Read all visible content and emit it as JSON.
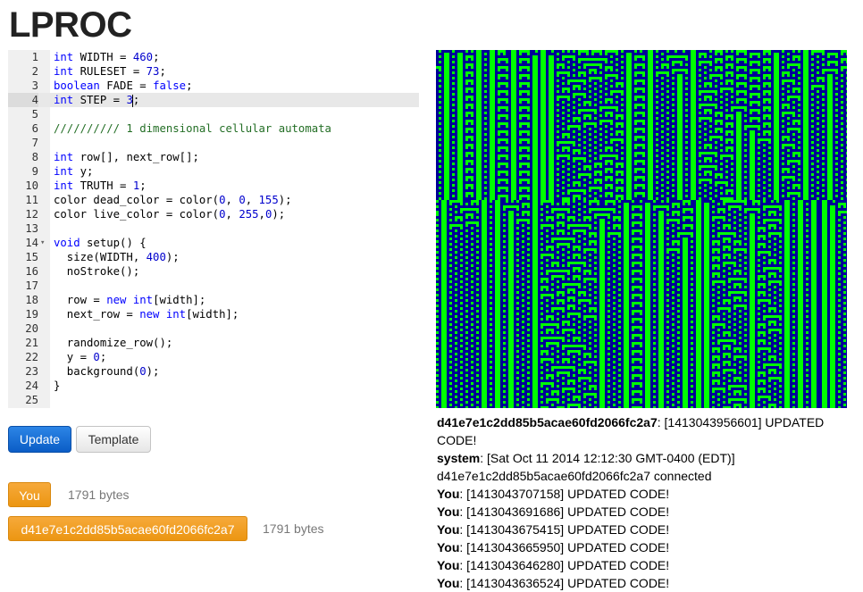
{
  "app_title": "LPROC",
  "editor": {
    "active_line": 4,
    "lines": [
      [
        {
          "t": "int",
          "c": "kw"
        },
        {
          "t": " WIDTH = "
        },
        {
          "t": "460",
          "c": "num"
        },
        {
          "t": ";"
        }
      ],
      [
        {
          "t": "int",
          "c": "kw"
        },
        {
          "t": " RULESET = "
        },
        {
          "t": "73",
          "c": "num"
        },
        {
          "t": ";"
        }
      ],
      [
        {
          "t": "boolean",
          "c": "kw"
        },
        {
          "t": " FADE = "
        },
        {
          "t": "false",
          "c": "kw"
        },
        {
          "t": ";"
        }
      ],
      [
        {
          "t": "int",
          "c": "kw"
        },
        {
          "t": " STEP = "
        },
        {
          "t": "3",
          "c": "num"
        },
        {
          "t": ";",
          "cursor": true
        }
      ],
      [],
      [
        {
          "t": "////////// 1 dimensional cellular automata",
          "c": "com"
        }
      ],
      [],
      [
        {
          "t": "int",
          "c": "kw"
        },
        {
          "t": " row[], next_row[];"
        }
      ],
      [
        {
          "t": "int",
          "c": "kw"
        },
        {
          "t": " y;"
        }
      ],
      [
        {
          "t": "int",
          "c": "kw"
        },
        {
          "t": " TRUTH = "
        },
        {
          "t": "1",
          "c": "num"
        },
        {
          "t": ";"
        }
      ],
      [
        {
          "t": "color dead_color = color("
        },
        {
          "t": "0",
          "c": "num"
        },
        {
          "t": ", "
        },
        {
          "t": "0",
          "c": "num"
        },
        {
          "t": ", "
        },
        {
          "t": "155",
          "c": "num"
        },
        {
          "t": ");"
        }
      ],
      [
        {
          "t": "color live_color = color("
        },
        {
          "t": "0",
          "c": "num"
        },
        {
          "t": ", "
        },
        {
          "t": "255",
          "c": "num"
        },
        {
          "t": ","
        },
        {
          "t": "0",
          "c": "num"
        },
        {
          "t": ");"
        }
      ],
      [],
      [
        {
          "t": "void",
          "c": "kw"
        },
        {
          "t": " setup() {"
        }
      ],
      [
        {
          "t": "  size(WIDTH, "
        },
        {
          "t": "400",
          "c": "num"
        },
        {
          "t": ");"
        }
      ],
      [
        {
          "t": "  noStroke();"
        }
      ],
      [],
      [
        {
          "t": "  row = "
        },
        {
          "t": "new",
          "c": "kw"
        },
        {
          "t": " "
        },
        {
          "t": "int",
          "c": "kw"
        },
        {
          "t": "[width];"
        }
      ],
      [
        {
          "t": "  next_row = "
        },
        {
          "t": "new",
          "c": "kw"
        },
        {
          "t": " "
        },
        {
          "t": "int",
          "c": "kw"
        },
        {
          "t": "[width];"
        }
      ],
      [],
      [
        {
          "t": "  randomize_row();"
        }
      ],
      [
        {
          "t": "  y = "
        },
        {
          "t": "0",
          "c": "num"
        },
        {
          "t": ";"
        }
      ],
      [
        {
          "t": "  background("
        },
        {
          "t": "0",
          "c": "num"
        },
        {
          "t": ");"
        }
      ],
      [
        {
          "t": "}"
        }
      ],
      []
    ],
    "fold_line": 14,
    "fold_marker": "▾"
  },
  "buttons": {
    "update": "Update",
    "template": "Template"
  },
  "clients": [
    {
      "label": "You",
      "bytes": "1791 bytes"
    },
    {
      "label": "d41e7e1c2dd85b5acae60fd2066fc2a7",
      "bytes": "1791 bytes"
    }
  ],
  "canvas": {
    "dead_color": "#000096",
    "live_color": "#00ff00"
  },
  "log": [
    {
      "user": "d41e7e1c2dd85b5acae60fd2066fc2a7",
      "msg": ": [1413043956601] UPDATED CODE!"
    },
    {
      "user": "system",
      "msg": ": [Sat Oct 11 2014 12:12:30 GMT-0400 (EDT)] d41e7e1c2dd85b5acae60fd2066fc2a7 connected"
    },
    {
      "user": "You",
      "msg": ": [1413043707158] UPDATED CODE!"
    },
    {
      "user": "You",
      "msg": ": [1413043691686] UPDATED CODE!"
    },
    {
      "user": "You",
      "msg": ": [1413043675415] UPDATED CODE!"
    },
    {
      "user": "You",
      "msg": ": [1413043665950] UPDATED CODE!"
    },
    {
      "user": "You",
      "msg": ": [1413043646280] UPDATED CODE!"
    },
    {
      "user": "You",
      "msg": ": [1413043636524] UPDATED CODE!"
    }
  ]
}
